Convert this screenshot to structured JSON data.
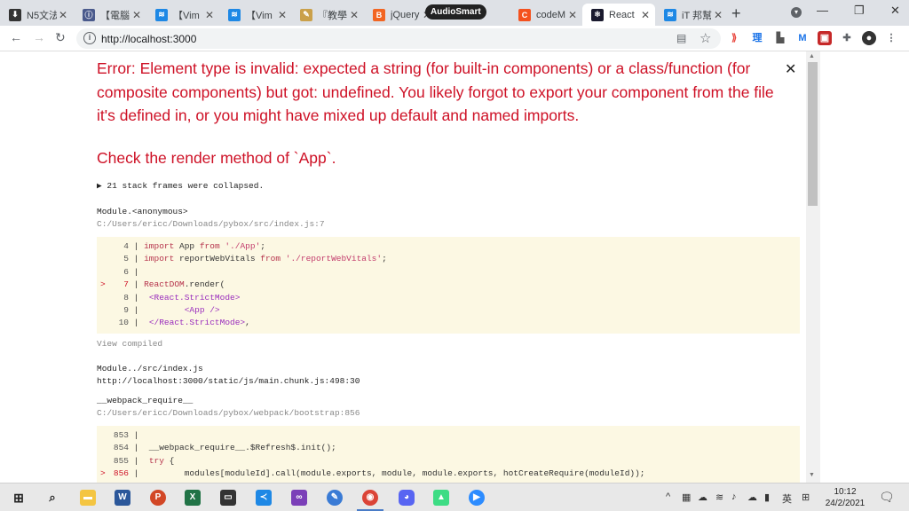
{
  "browser": {
    "tabs": [
      {
        "title": "N5文法",
        "favicon_color": "#333333",
        "favicon_glyph": "⬇"
      },
      {
        "title": "【電腦",
        "favicon_color": "#4a5a8c",
        "favicon_glyph": "ⓘ"
      },
      {
        "title": "【Vim",
        "favicon_color": "#1e88e5",
        "favicon_glyph": "≋"
      },
      {
        "title": "【Vim",
        "favicon_color": "#1e88e5",
        "favicon_glyph": "≋"
      },
      {
        "title": "『教學",
        "favicon_color": "#caa04a",
        "favicon_glyph": "✎"
      },
      {
        "title": "jQuery",
        "favicon_color": "#f26522",
        "favicon_glyph": "B"
      },
      {
        "title": "codeM",
        "favicon_color": "#f4511e",
        "favicon_glyph": "C"
      },
      {
        "title": "React",
        "favicon_color": "#1a1a2e",
        "favicon_glyph": "⚛",
        "active": true
      },
      {
        "title": "iT 邦幫",
        "favicon_color": "#1e88e5",
        "favicon_glyph": "≋"
      }
    ],
    "audiosmart_badge": "AudioSmart",
    "new_tab_label": "+",
    "url": "http://localhost:3000",
    "omnibox_icons": [
      "info-icon",
      "translate-icon",
      "bookmark-star-icon"
    ],
    "extension_icons": [
      "arrow-extension-icon",
      "dictionary-icon",
      "car-icon",
      "m-icon",
      "red-square-icon",
      "puzzle-icon",
      "profile-avatar-icon",
      "more-menu-icon"
    ]
  },
  "error_overlay": {
    "title": "Error: Element type is invalid: expected a string (for built-in components) or a class/function (for composite components) but got: undefined. You likely forgot to export your component from the file it's defined in, or you might have mixed up default and named imports.",
    "render_message": "Check the render method of `App`.",
    "collapsed_label": "▶ 21 stack frames were collapsed.",
    "frames": [
      {
        "name": "Module.<anonymous>",
        "path": "C:/Users/ericc/Downloads/pybox/src/index.js:7",
        "code": [
          {
            "num": "4",
            "text": "import App from './App';"
          },
          {
            "num": "5",
            "text": "import reportWebVitals from './reportWebVitals';"
          },
          {
            "num": "6",
            "text": ""
          },
          {
            "num": "7",
            "text": "ReactDOM.render(",
            "highlight": true
          },
          {
            "num": "8",
            "text": " <React.StrictMode>"
          },
          {
            "num": "9",
            "text": "        <App />"
          },
          {
            "num": "10",
            "text": " </React.StrictMode>,"
          }
        ],
        "view_compiled": "View compiled"
      },
      {
        "name": "Module../src/index.js",
        "path": "http://localhost:3000/static/js/main.chunk.js:498:30"
      },
      {
        "name": "__webpack_require__",
        "path": "C:/Users/ericc/Downloads/pybox/webpack/bootstrap:856",
        "code": [
          {
            "num": "853",
            "text": ""
          },
          {
            "num": "854",
            "text": " __webpack_require__.$Refresh$.init();"
          },
          {
            "num": "855",
            "text": " try {"
          },
          {
            "num": "856",
            "text": "        modules[moduleId].call(module.exports, module, module.exports, hotCreateRequire(moduleId));",
            "highlight": true
          }
        ]
      }
    ]
  },
  "taskbar": {
    "apps": [
      "windows-start-icon",
      "search-icon",
      "file-explorer-icon",
      "word-icon",
      "powerpoint-icon",
      "excel-icon",
      "terminal-icon",
      "vscode-icon",
      "visual-studio-icon",
      "notepad-icon",
      "chrome-icon",
      "discord-icon",
      "android-icon",
      "zoom-icon"
    ],
    "tray_language": "英",
    "time": "10:12",
    "date": "24/2/2021"
  }
}
